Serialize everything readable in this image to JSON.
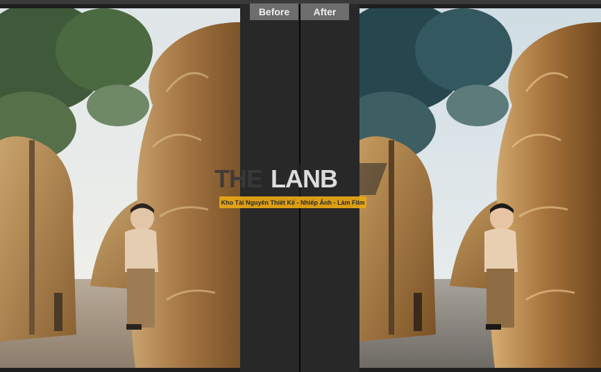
{
  "compare": {
    "before_label": "Before",
    "after_label": "After"
  },
  "watermark": {
    "logo_dark": "THE",
    "logo_light": "LANB",
    "tagline": "Kho Tài Nguyên Thiết Kế - Nhiếp Ảnh - Làm Film",
    "accent_color": "#e8a814"
  },
  "colors": {
    "gutter": "#282828",
    "tab_bg": "#6e6e6e",
    "divider": "#050505"
  }
}
